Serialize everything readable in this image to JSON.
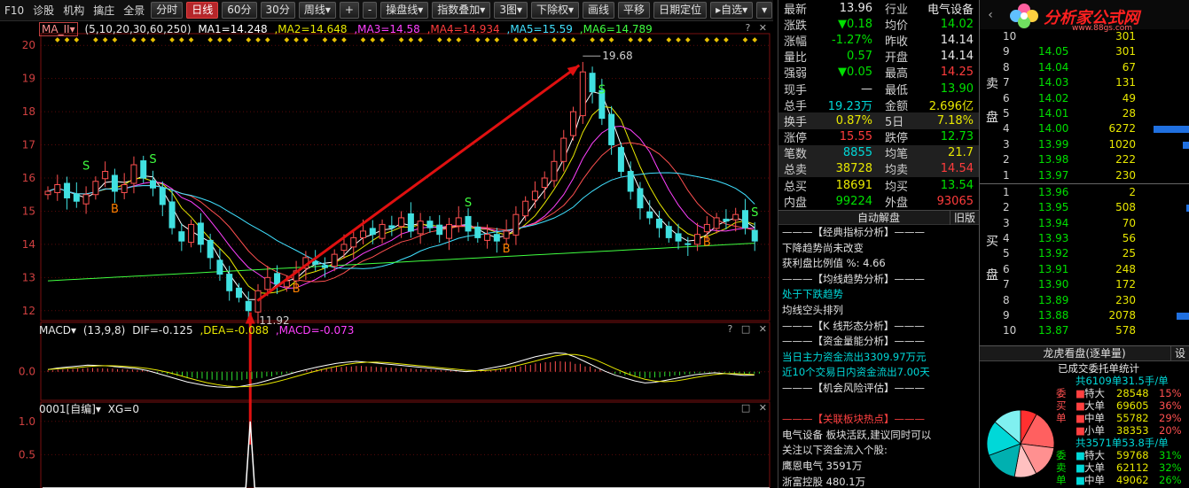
{
  "toolbar": {
    "items": [
      "F10",
      "诊股",
      "机构",
      "擒庄",
      "全景"
    ],
    "buttons": [
      "分时",
      "日线",
      "60分",
      "30分",
      "周线▾",
      "+",
      "-",
      "操盘线▾",
      "指数叠加▾",
      "3图▾",
      "下除权▾",
      "画线",
      "平移",
      "日期定位",
      "▸自选▾",
      "▾"
    ]
  },
  "main_header": {
    "indicator": "MA_II▾",
    "params": "(5,10,20,30,60,250)",
    "ma1": "MA1=14.248",
    "ma2": ",MA2=14.648",
    "ma3": ",MA3=14.58",
    "ma4": ",MA4=14.934",
    "ma5": ",MA5=15.59",
    "ma6": ",MA6=14.789",
    "win": "? ✕"
  },
  "macd_header": {
    "indicator": "MACD▾",
    "params": "(13,9,8)",
    "dif": "DIF=-0.125",
    "dea": ",DEA=-0.088",
    "macd": ",MACD=-0.073",
    "win": "? □ ✕"
  },
  "xg_header": {
    "indicator": "0001[自编]▾",
    "value": "XG=0",
    "win": "□ ✕"
  },
  "colors": {
    "ma1": "#ffffff",
    "ma2": "#e8e800",
    "ma3": "#ff40ff",
    "ma4": "#ff5050",
    "ma5": "#40e0ff",
    "ma6": "#40ff40",
    "up": "#ff5050",
    "down": "#40e0e0",
    "arrow": "#e01010"
  },
  "chart_data": [
    {
      "type": "candlestick",
      "title": "",
      "ylim": [
        11.7,
        20.3
      ],
      "y_ticks": [
        "12",
        "13",
        "14",
        "15",
        "16",
        "17",
        "18",
        "19",
        "20"
      ],
      "annotations": {
        "high": "19.68",
        "low": "11.92"
      },
      "signals": [
        {
          "text": "S",
          "index": 4
        },
        {
          "text": "B",
          "index": 7
        },
        {
          "text": "S",
          "index": 11
        },
        {
          "text": "B",
          "index": 26
        },
        {
          "text": "S",
          "index": 44
        },
        {
          "text": "B",
          "index": 48
        },
        {
          "text": "S",
          "index": 58
        },
        {
          "text": "B",
          "index": 69
        },
        {
          "text": "S",
          "index": 74
        }
      ],
      "close": [
        15.6,
        15.8,
        15.4,
        15.3,
        15.5,
        15.9,
        16.2,
        15.6,
        15.8,
        16.4,
        16.0,
        15.7,
        15.2,
        14.5,
        14.1,
        14.6,
        14.0,
        13.6,
        13.1,
        12.6,
        12.4,
        12.0,
        12.6,
        13.0,
        12.8,
        12.9,
        13.2,
        13.6,
        13.4,
        13.3,
        13.7,
        14.0,
        14.2,
        14.4,
        14.3,
        14.6,
        14.5,
        14.8,
        14.4,
        14.7,
        14.5,
        14.3,
        14.6,
        14.8,
        14.4,
        14.2,
        14.3,
        14.1,
        14.4,
        14.9,
        15.3,
        15.6,
        16.0,
        16.5,
        17.2,
        18.0,
        19.2,
        18.6,
        17.8,
        17.0,
        16.2,
        15.6,
        15.1,
        14.8,
        14.5,
        14.2,
        14.1,
        14.0,
        14.3,
        14.6,
        14.8,
        14.7,
        14.9,
        14.5,
        14.1
      ]
    },
    {
      "type": "bar",
      "title": "",
      "series": [
        {
          "name": "DIF"
        },
        {
          "name": "DEA"
        }
      ],
      "ylim": [
        -0.6,
        0.7
      ],
      "y_ticks": [
        "0.0"
      ],
      "macd": [
        0.05,
        0.08,
        0.1,
        0.12,
        0.14,
        0.13,
        0.12,
        0.1,
        0.08,
        0.06,
        0.02,
        -0.04,
        -0.1,
        -0.16,
        -0.22,
        -0.26,
        -0.3,
        -0.32,
        -0.33,
        -0.32,
        -0.28,
        -0.24,
        -0.18,
        -0.12,
        -0.06,
        0.0,
        0.05,
        0.1,
        0.14,
        0.18,
        0.2,
        0.22,
        0.2,
        0.18,
        0.16,
        0.14,
        0.12,
        0.1,
        0.08,
        0.06,
        0.04,
        0.02,
        0.0,
        0.02,
        0.06,
        0.1,
        0.14,
        0.2,
        0.26,
        0.32,
        0.36,
        0.4,
        0.38,
        0.3,
        0.2,
        0.1,
        0.0,
        -0.08,
        -0.14,
        -0.2,
        -0.24,
        -0.22,
        -0.18,
        -0.14,
        -0.1,
        -0.06,
        -0.04,
        -0.02,
        -0.04,
        -0.06,
        -0.08,
        -0.07
      ]
    },
    {
      "type": "line",
      "title": "",
      "ylim": [
        0,
        1.05
      ],
      "y_ticks": [
        "1.0",
        "0.5"
      ],
      "xg": {
        "peak_index": 22,
        "value": 1.0
      }
    }
  ],
  "quote": [
    [
      "最新",
      "13.96",
      "wht",
      "行业",
      "电气设备",
      "wht"
    ],
    [
      "涨跌",
      "▼0.18",
      "grn",
      "均价",
      "14.02",
      "grn"
    ],
    [
      "涨幅",
      "-1.27%",
      "grn",
      "昨收",
      "14.14",
      "wht"
    ],
    [
      "量比",
      "0.57",
      "grn",
      "开盘",
      "14.14",
      "wht"
    ],
    [
      "强弱",
      "▼0.05",
      "grn",
      "最高",
      "14.25",
      "red"
    ],
    [
      "现手",
      "—",
      "wht",
      "最低",
      "13.90",
      "grn"
    ],
    [
      "总手",
      "19.23万",
      "cyn",
      "金额",
      "2.696亿",
      "yel"
    ],
    [
      "换手",
      "0.87%",
      "yel",
      "5日",
      "7.18%",
      "yel"
    ],
    [
      "涨停",
      "15.55",
      "red",
      "跌停",
      "12.73",
      "grn"
    ],
    [
      "笔数",
      "8855",
      "cyn",
      "均笔",
      "21.7",
      "yel"
    ],
    [
      "总卖",
      "38728",
      "yel",
      "均卖",
      "14.54",
      "red"
    ],
    [
      "总买",
      "18691",
      "yel",
      "均买",
      "13.54",
      "grn"
    ],
    [
      "内盘",
      "99224",
      "grn",
      "外盘",
      "93065",
      "red"
    ]
  ],
  "auto": {
    "title": "自动解盘",
    "old": "旧版",
    "lines": [
      {
        "t": "———【经典指标分析】———",
        "c": "wht"
      },
      {
        "t": "下降趋势尚未改变",
        "c": "wht"
      },
      {
        "t": "获利盘比例值 %: 4.66",
        "c": "wht"
      },
      {
        "t": "———【均线趋势分析】———",
        "c": "wht"
      },
      {
        "t": "处于下跌趋势",
        "c": "cyn"
      },
      {
        "t": "均线空头排列",
        "c": "wht"
      },
      {
        "t": "———【K 线形态分析】———",
        "c": "wht"
      },
      {
        "t": "———【资金量能分析】———",
        "c": "wht"
      },
      {
        "t": "当日主力资金流出3309.97万元",
        "c": "cyn"
      },
      {
        "t": "近10个交易日内资金流出7.00天",
        "c": "cyn"
      },
      {
        "t": "———【机会风险评估】———",
        "c": "wht"
      },
      {
        "t": "",
        "c": "wht"
      },
      {
        "t": "———【关联板块热点】———",
        "c": "red"
      },
      {
        "t": "电气设备 板块活跃,建议同时可以",
        "c": "wht"
      },
      {
        "t": "关注以下资金流入个股:",
        "c": "wht"
      },
      {
        "t": "鹰恩电气 3591万",
        "c": "wht"
      },
      {
        "t": "浙富控股 480.1万",
        "c": "wht"
      }
    ]
  },
  "book": {
    "logo": "分析家公式网",
    "logo_url": "www.88gs.com",
    "sell_label": [
      "卖",
      "盘"
    ],
    "buy_label": [
      "买",
      "盘"
    ],
    "sell": [
      [
        "10",
        "",
        "301",
        0
      ],
      [
        "9",
        "14.05",
        "301",
        0
      ],
      [
        "8",
        "14.04",
        "67",
        0
      ],
      [
        "7",
        "14.03",
        "131",
        0
      ],
      [
        "6",
        "14.02",
        "49",
        0
      ],
      [
        "5",
        "14.01",
        "28",
        0
      ],
      [
        "4",
        "14.00",
        "6272",
        40
      ],
      [
        "3",
        "13.99",
        "1020",
        7
      ],
      [
        "2",
        "13.98",
        "222",
        0
      ],
      [
        "1",
        "13.97",
        "230",
        0
      ]
    ],
    "buy": [
      [
        "1",
        "13.96",
        "2",
        0
      ],
      [
        "2",
        "13.95",
        "508",
        3
      ],
      [
        "3",
        "13.94",
        "70",
        0
      ],
      [
        "4",
        "13.93",
        "56",
        0
      ],
      [
        "5",
        "13.92",
        "25",
        0
      ],
      [
        "6",
        "13.91",
        "248",
        0
      ],
      [
        "7",
        "13.90",
        "172",
        0
      ],
      [
        "8",
        "13.89",
        "230",
        0
      ],
      [
        "9",
        "13.88",
        "2078",
        14
      ],
      [
        "10",
        "13.87",
        "578",
        0
      ]
    ]
  },
  "lhk": {
    "title": "龙虎看盘(逐单量)",
    "set": "设",
    "sub": "已成交委托单统计",
    "buy_total": "共6109单31.5手/单",
    "buy_label": "委买单",
    "buy_rows": [
      [
        "特大",
        "28548",
        "15%"
      ],
      [
        "大单",
        "69605",
        "36%"
      ],
      [
        "中单",
        "55782",
        "29%"
      ],
      [
        "小单",
        "38353",
        "20%"
      ]
    ],
    "sell_total": "共3571单53.8手/单",
    "sell_label": "委卖单",
    "sell_rows": [
      [
        "特大",
        "59768",
        "31%"
      ],
      [
        "大单",
        "62112",
        "32%"
      ],
      [
        "中单",
        "49062",
        "26%"
      ]
    ],
    "pie": [
      15,
      36,
      29,
      20,
      31,
      32,
      26
    ]
  }
}
